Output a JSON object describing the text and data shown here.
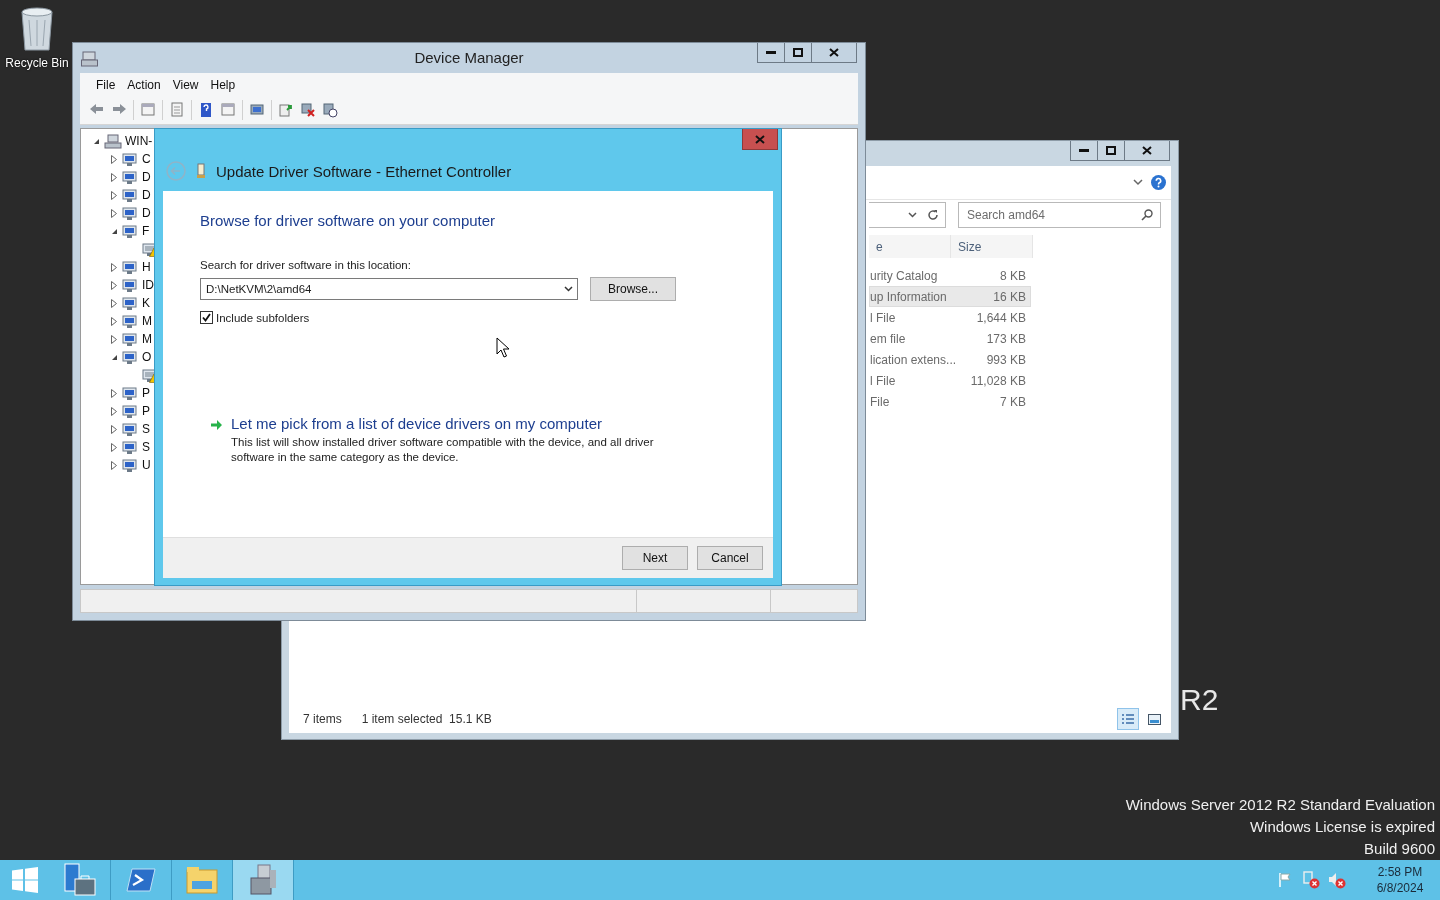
{
  "desktop": {
    "recycle_bin": "Recycle Bin",
    "branding": "R2",
    "watermark": [
      "Windows Server 2012 R2 Standard Evaluation",
      "Windows License is expired",
      "Build 9600"
    ]
  },
  "explorer": {
    "search": {
      "placeholder": "Search amd64"
    },
    "columns": [
      "e",
      "Size"
    ],
    "rows": [
      {
        "type": "urity Catalog",
        "size": "8 KB",
        "selected": false
      },
      {
        "type": "up Information",
        "size": "16 KB",
        "selected": true
      },
      {
        "type": "l File",
        "size": "1,644 KB",
        "selected": false
      },
      {
        "type": "em file",
        "size": "173 KB",
        "selected": false
      },
      {
        "type": "lication extens...",
        "size": "993 KB",
        "selected": false
      },
      {
        "type": "l File",
        "size": "11,028 KB",
        "selected": false
      },
      {
        "type": "File",
        "size": "7 KB",
        "selected": false
      }
    ],
    "status": {
      "count": "7 items",
      "selection": "1 item selected  15.1 KB"
    }
  },
  "device_manager": {
    "title": "Device Manager",
    "menu": [
      "File",
      "Action",
      "View",
      "Help"
    ],
    "tree": {
      "label": "WIN-",
      "expanded": true,
      "children": [
        {
          "label": "C",
          "expanded": false
        },
        {
          "label": "D",
          "expanded": false
        },
        {
          "label": "D",
          "expanded": false
        },
        {
          "label": "D",
          "expanded": false
        },
        {
          "label": "F",
          "expanded": true,
          "children": [
            {
              "warning": true
            }
          ]
        },
        {
          "label": "H",
          "expanded": false
        },
        {
          "label": "ID",
          "expanded": false
        },
        {
          "label": "K",
          "expanded": false
        },
        {
          "label": "M",
          "expanded": false
        },
        {
          "label": "M",
          "expanded": false
        },
        {
          "label": "O",
          "expanded": true,
          "children": [
            {
              "warning": true
            }
          ]
        },
        {
          "label": "P",
          "expanded": false
        },
        {
          "label": "P",
          "expanded": false
        },
        {
          "label": "S",
          "expanded": false
        },
        {
          "label": "S",
          "expanded": false
        },
        {
          "label": "U",
          "expanded": false
        }
      ]
    }
  },
  "dialog": {
    "title": "Update Driver Software - Ethernet Controller",
    "heading": "Browse for driver software on your computer",
    "location_label": "Search for driver software in this location:",
    "location_value": "D:\\NetKVM\\2\\amd64",
    "browse": "Browse...",
    "include_subfolders": {
      "label": "Include subfolders",
      "checked": true
    },
    "pick_link": "Let me pick from a list of device drivers on my computer",
    "pick_description": "This list will show installed driver software compatible with the device, and all driver software in the same category as the device.",
    "buttons": [
      "Next",
      "Cancel"
    ]
  },
  "taskbar": {
    "apps": [
      {
        "kind": "server-manager",
        "selected": false
      },
      {
        "kind": "powershell",
        "selected": false
      },
      {
        "kind": "explorer",
        "selected": false
      },
      {
        "kind": "device-manager",
        "selected": true
      }
    ],
    "clock": {
      "time": "2:58 PM",
      "date": "6/8/2024"
    }
  }
}
